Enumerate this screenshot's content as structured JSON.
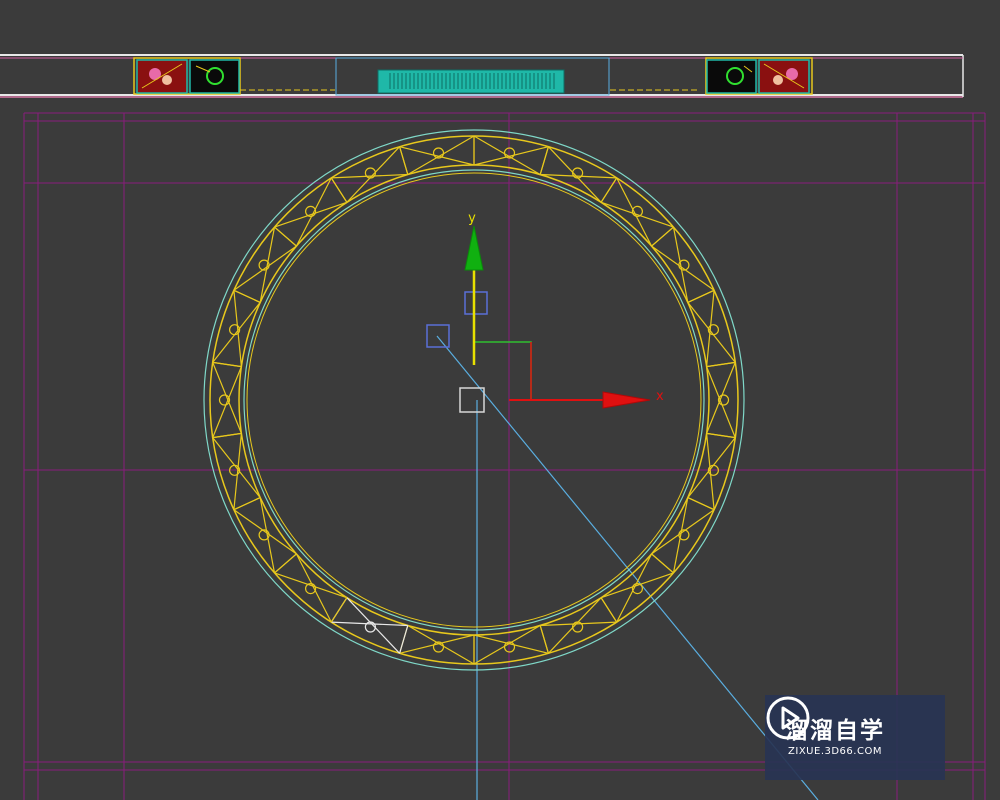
{
  "viewport": {
    "background": "#3b3b3b",
    "gizmo": {
      "y_axis_label": "y",
      "x_axis_label": "x",
      "y_axis_color": "#10b010",
      "x_axis_color": "#e01010",
      "stem_color": "#e8e000"
    },
    "colors": {
      "grid": "#8a1c7c",
      "ring": "#e8c81c",
      "ring_outline": "#7fd8c8",
      "cable": "#5aaee0",
      "handle": "#5a6fd8",
      "selected_segment": "#e8e8e8",
      "top_panel": "#e060a0",
      "accent_teal": "#1fb8a8"
    }
  },
  "watermark": {
    "title": "溜溜自学",
    "url": "ZIXUE.3D66.COM",
    "logo_icon": "play-icon"
  }
}
